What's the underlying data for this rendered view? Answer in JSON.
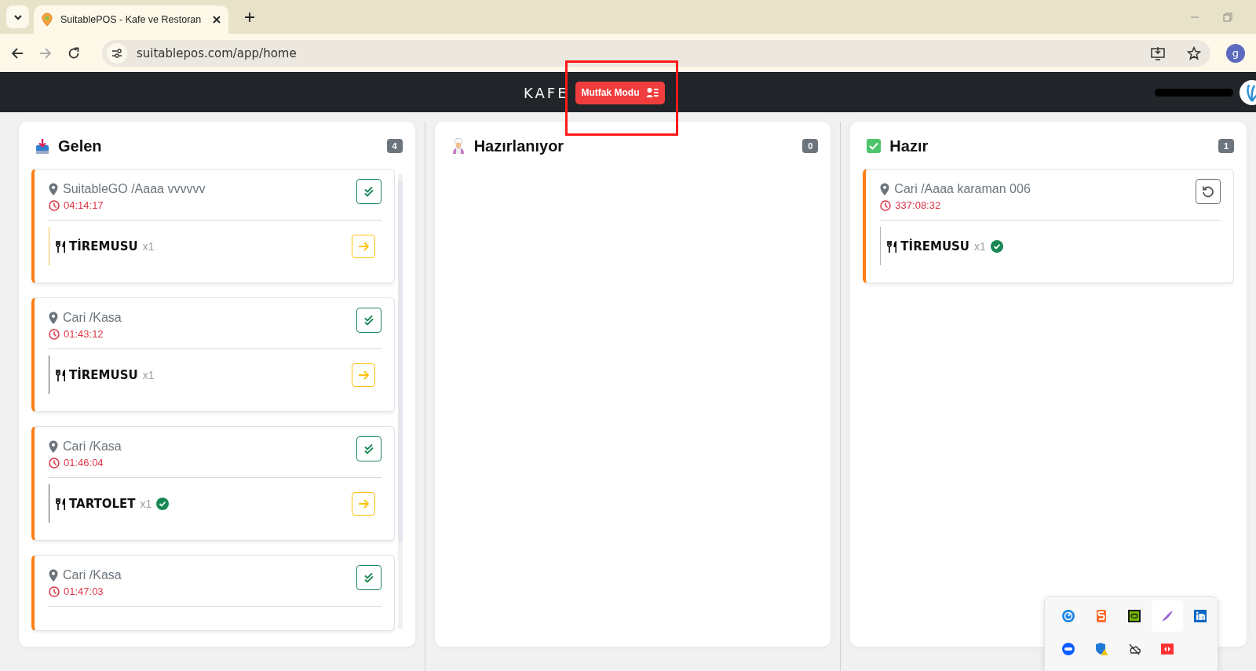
{
  "browser": {
    "tab_title": "SuitablePOS - Kafe ve Restoran",
    "address": "suitablepos.com/app/home",
    "profile_initial": "g"
  },
  "header": {
    "brand": "KAFE",
    "mode_button": "Mutfak Modu"
  },
  "columns": [
    {
      "kind": "incoming",
      "title": "Gelen",
      "count": "4",
      "orders": [
        {
          "location": "SuitableGO /Aaaa vvvvvv",
          "elapsed": "04:14:17",
          "kind": "confirm",
          "items": [
            {
              "name": "TİREMUSU",
              "qty": "x1",
              "done": false,
              "color": "#f5c242"
            }
          ]
        },
        {
          "location": "Cari /Kasa",
          "elapsed": "01:43:12",
          "kind": "confirm",
          "items": [
            {
              "name": "TİREMUSU",
              "qty": "x1",
              "done": false,
              "color": "#555b61"
            }
          ]
        },
        {
          "location": "Cari /Kasa",
          "elapsed": "01:46:04",
          "kind": "confirm",
          "items": [
            {
              "name": "TARTOLET",
              "qty": "x1",
              "done": true,
              "color": "#555b61"
            }
          ]
        },
        {
          "location": "Cari /Kasa",
          "elapsed": "01:47:03",
          "kind": "confirm"
        }
      ]
    },
    {
      "kind": "preparing",
      "title": "Hazırlanıyor",
      "count": "0"
    },
    {
      "kind": "ready",
      "title": "Hazır",
      "count": "1",
      "orders": [
        {
          "location": "Cari /Aaaa karaman 006",
          "elapsed": "337:08:32",
          "kind": "undo",
          "items": [
            {
              "name": "TİREMUSU",
              "qty": "x1",
              "done": true,
              "color": "#adb5bd"
            }
          ]
        }
      ]
    }
  ]
}
